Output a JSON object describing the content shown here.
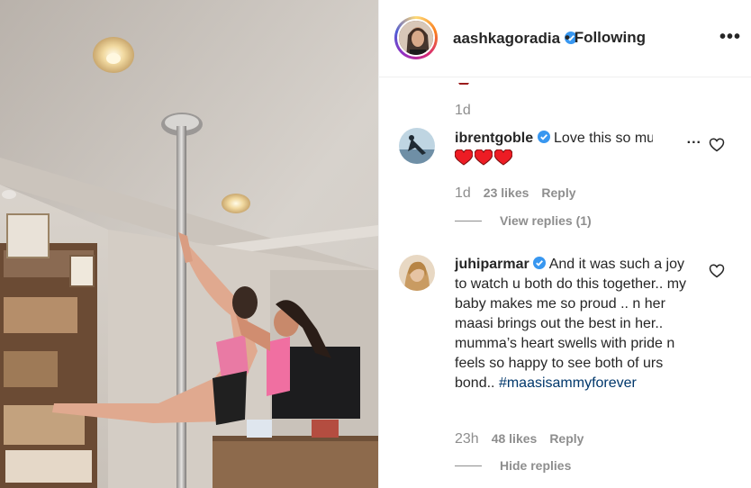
{
  "post": {
    "username": "aashkagoradia",
    "verified": true,
    "separator": "•",
    "follow_status": "Following",
    "more_label": "•••"
  },
  "caption_timestamp": "1d",
  "comments": [
    {
      "username": "ibrentgoble",
      "verified": true,
      "text": "Love this so much",
      "truncated_more": "...",
      "emoji": [
        "heart",
        "heart",
        "heart"
      ],
      "timestamp": "1d",
      "likes": "23 likes",
      "reply_label": "Reply",
      "replies_toggle": "View replies (1)"
    },
    {
      "username": "juhiparmar",
      "verified": true,
      "text": "And it was such a joy to watch u both do this together.. my baby makes me so proud .. n her maasi brings out the best in her.. mumma’s heart swells with pride n feels so happy to see both of urs bond..",
      "hashtag": "#maasisammyforever",
      "timestamp": "23h",
      "likes": "48 likes",
      "reply_label": "Reply",
      "replies_toggle": "Hide replies"
    }
  ],
  "colors": {
    "text_primary": "#262626",
    "text_secondary": "#8e8e8e",
    "verified_blue": "#3897f0",
    "hashtag": "#00376b",
    "heart_red": "#ed1c24"
  },
  "icons": [
    "verified-badge-icon",
    "more-options-icon",
    "heart-outline-icon",
    "red-heart-emoji"
  ]
}
